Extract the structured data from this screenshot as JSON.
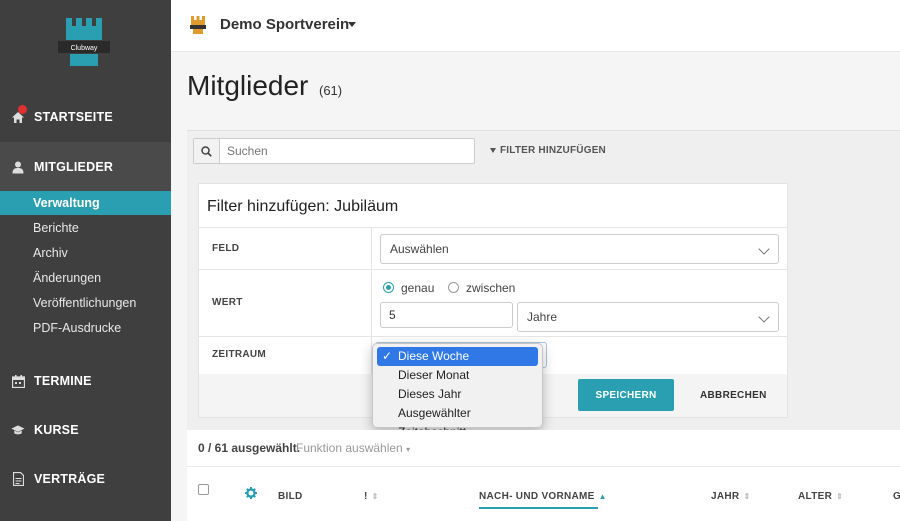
{
  "sidebar": {
    "logo_text": "Clubway",
    "sections": [
      {
        "label": "STARTSEITE",
        "icon": "home-icon"
      },
      {
        "label": "MITGLIEDER",
        "icon": "user-icon"
      },
      {
        "label": "TERMINE",
        "icon": "calendar-icon"
      },
      {
        "label": "KURSE",
        "icon": "graduation-cap-icon"
      },
      {
        "label": "VERTRÄGE",
        "icon": "document-icon"
      }
    ],
    "sub_items": [
      "Verwaltung",
      "Berichte",
      "Archiv",
      "Änderungen",
      "Veröffentlichungen",
      "PDF-Ausdrucke"
    ]
  },
  "topbar": {
    "club_name": "Demo Sportverein"
  },
  "page": {
    "title": "Mitglieder",
    "count": "(61)"
  },
  "toolbar": {
    "search_placeholder": "Suchen",
    "filter_add_label": "FILTER HINZUFÜGEN"
  },
  "filter": {
    "title": "Filter hinzufügen: Jubiläum",
    "feld_label": "FELD",
    "feld_value": "Auswählen",
    "wert_label": "WERT",
    "radio_exact": "genau",
    "radio_between": "zwischen",
    "wert_value": "5",
    "unit_value": "Jahre",
    "zeitraum_label": "ZEITRAUM",
    "save_label": "SPEICHERN",
    "cancel_label": "ABBRECHEN"
  },
  "dropdown": {
    "options": [
      "Diese Woche",
      "Dieser Monat",
      "Dieses Jahr",
      "Ausgewählter Zeitabschnitt"
    ],
    "selected_index": 0
  },
  "list": {
    "selected_info": "0 / 61 ausgewählt.",
    "function_select": "Funktion auswählen",
    "columns": {
      "bild": "BILD",
      "exclaim": "!",
      "name": "NACH- UND VORNAME",
      "jahr": "JAHR",
      "alter": "ALTER",
      "g": "G"
    }
  },
  "colors": {
    "accent": "#2a9fb1",
    "sidebar": "#3f3f3f",
    "selection": "#2f78e6"
  }
}
